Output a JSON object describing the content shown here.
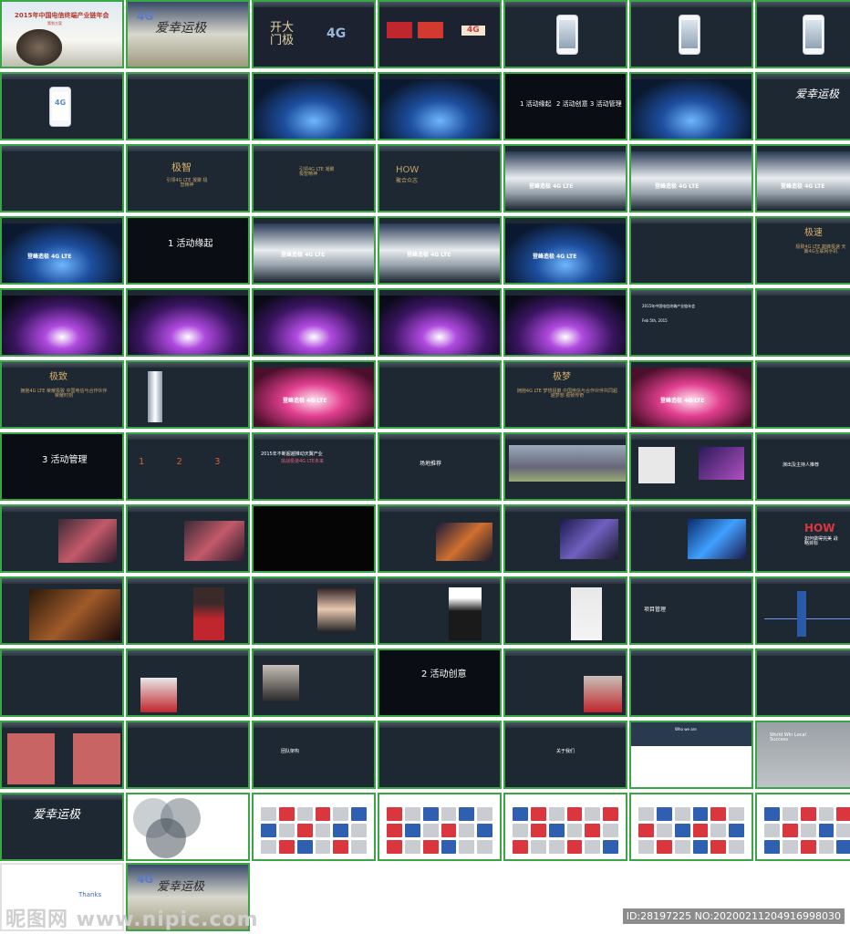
{
  "watermark": "昵图网 www.nipic.com",
  "image_id_line": "ID:28197225 NO:20200211204916998030",
  "slides": [
    {
      "title": "2015年中国电信终端产业链年会",
      "subtitle": "策划方案"
    },
    {
      "title": "爱幸运极",
      "subtitle": "4G"
    },
    {
      "title": "开大门极",
      "subtitle": "4G"
    },
    {
      "title": "4G"
    },
    {
      "title": ""
    },
    {
      "title": ""
    },
    {
      "title": ""
    },
    {
      "title": "4G"
    },
    {
      "title": ""
    },
    {
      "title": ""
    },
    {
      "title": ""
    },
    {
      "title": "1 活动缘起",
      "subtitle": "2 活动创意 3 活动管理"
    },
    {
      "title": ""
    },
    {
      "title": "爱幸运极"
    },
    {
      "title": ""
    },
    {
      "title": "极智",
      "subtitle": "引领4G LTE 凝聚 极智精神"
    },
    {
      "title": "引领4G LTE 凝聚 极智精神"
    },
    {
      "title": "HOW",
      "subtitle": "聚合众志"
    },
    {
      "title": "登峰造极 4G LTE"
    },
    {
      "title": "登峰造极 4G LTE"
    },
    {
      "title": "登峰造极 4G LTE"
    },
    {
      "title": "登峰造极 4G LTE"
    },
    {
      "title": "1 活动缘起"
    },
    {
      "title": "登峰造极 4G LTE"
    },
    {
      "title": "登峰造极 4G LTE"
    },
    {
      "title": "登峰造极 4G LTE"
    },
    {
      "title": ""
    },
    {
      "title": "极速",
      "subtitle": "极致4G LTE 巅峰极速 天翼4G互联网手机"
    },
    {
      "title": ""
    },
    {
      "title": ""
    },
    {
      "title": ""
    },
    {
      "title": ""
    },
    {
      "title": ""
    },
    {
      "title": "2015年中国电信终端产业链年会",
      "subtitle": "Feb 5th, 2015"
    },
    {
      "title": ""
    },
    {
      "title": "极致",
      "subtitle": "拥抱4G LTE 荣耀极致 中国电信与合作伙伴荣耀时刻"
    },
    {
      "title": ""
    },
    {
      "title": "登峰造极 4G LTE"
    },
    {
      "title": ""
    },
    {
      "title": "极梦",
      "subtitle": "拥抱4G LTE 梦想极聚 中国电信与合作伙伴共同超越梦想 极致传奇"
    },
    {
      "title": "登峰造极 4G LTE"
    },
    {
      "title": ""
    },
    {
      "title": "3 活动管理"
    },
    {
      "title": "1 2 3 4 5"
    },
    {
      "title": "2015年不断超越推动天翼产业",
      "subtitle": "挑战极速4G LTE未来"
    },
    {
      "title": "场地推荐"
    },
    {
      "title": ""
    },
    {
      "title": ""
    },
    {
      "title": "演出及主持人推荐"
    },
    {
      "title": ""
    },
    {
      "title": ""
    },
    {
      "title": ""
    },
    {
      "title": ""
    },
    {
      "title": ""
    },
    {
      "title": ""
    },
    {
      "title": "HOW",
      "subtitle": "如何做得完美 战略目标"
    },
    {
      "title": ""
    },
    {
      "title": ""
    },
    {
      "title": ""
    },
    {
      "title": ""
    },
    {
      "title": ""
    },
    {
      "title": "项目管理"
    },
    {
      "title": ""
    },
    {
      "title": ""
    },
    {
      "title": ""
    },
    {
      "title": ""
    },
    {
      "title": "2 活动创意"
    },
    {
      "title": ""
    },
    {
      "title": ""
    },
    {
      "title": ""
    },
    {
      "title": ""
    },
    {
      "title": ""
    },
    {
      "title": "团队架构"
    },
    {
      "title": ""
    },
    {
      "title": "关于我们"
    },
    {
      "title": "Who we are"
    },
    {
      "title": "World Win Local Success"
    },
    {
      "title": "爱幸运极"
    },
    {
      "title": ""
    },
    {
      "title": ""
    },
    {
      "title": ""
    },
    {
      "title": ""
    },
    {
      "title": ""
    },
    {
      "title": ""
    },
    {
      "title": "Thanks"
    },
    {
      "title": "爱幸运极",
      "subtitle": "4G"
    }
  ]
}
